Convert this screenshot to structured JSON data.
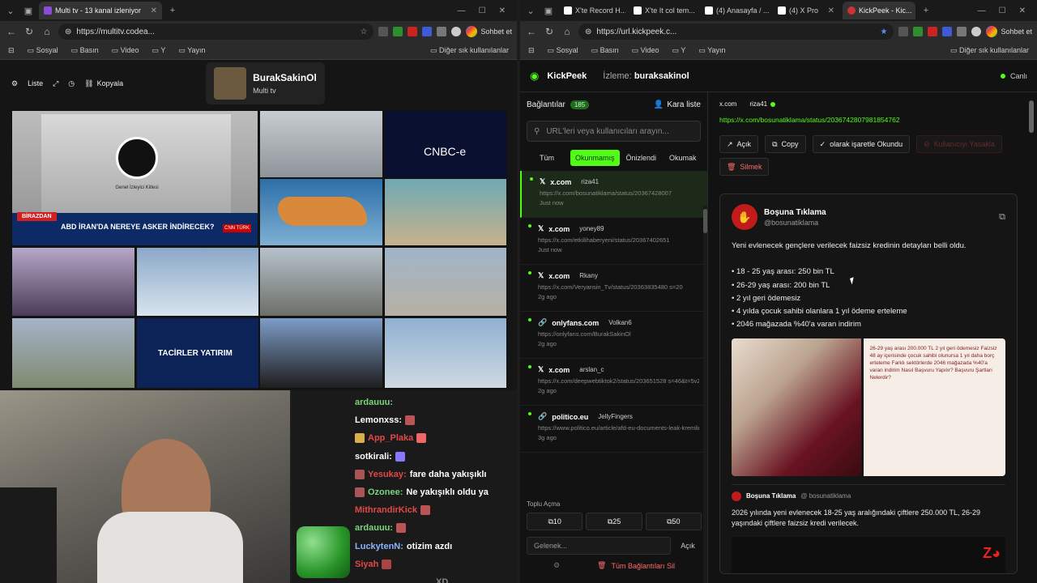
{
  "left_browser": {
    "tab": {
      "title": "Multi tv - 13 kanal izleniyor"
    },
    "url": "https://multitv.codea...",
    "chat_button": "Sohbet et",
    "bookmarks": [
      "Sosyal",
      "Basın",
      "Video",
      "Y",
      "Yayın"
    ],
    "bookmarks_right": "Diğer sık kullanılanlar"
  },
  "multitv": {
    "toolbar": {
      "list_label": "Liste",
      "copy_label": "Kopyala"
    },
    "profile": {
      "name": "BurakSakinOl",
      "subtitle": "Multi tv"
    },
    "channels": {
      "c1_caption": "Genel İzleyici Kitlesi",
      "c1_headline": "ABD İRAN'DA NEREYE ASKER İNDİRECEK?",
      "c1_badge": "BİRAZDAN",
      "c1_logo": "CNN TÜRK",
      "c2_logo": "CNBC-e",
      "c3_logo": "TACİRLER YATIRIM"
    }
  },
  "stream_chat": [
    {
      "user": "ardauuu:",
      "msg": "",
      "user_color": "#7ad47a"
    },
    {
      "user": "Lemonxss:",
      "msg": "",
      "user_color": "#ffffff"
    },
    {
      "user": "App_Plaka",
      "msg": "",
      "user_color": "#e34848"
    },
    {
      "user": "sotkirali:",
      "msg": "",
      "user_color": "#ffffff"
    },
    {
      "user": "Yesukay:",
      "msg": "fare daha yakışıklı",
      "user_color": "#e34848"
    },
    {
      "user": "Ozonee:",
      "msg": "Ne yakışıklı oldu ya",
      "user_color": "#7ad47a"
    },
    {
      "user": "MithrandirKick",
      "msg": "",
      "user_color": "#e34848"
    },
    {
      "user": "ardauuu:",
      "msg": "",
      "user_color": "#7ad47a"
    },
    {
      "user": "LuckytenN:",
      "msg": "otizim azdı",
      "user_color": "#8ab4ff"
    },
    {
      "user": "Siyah",
      "msg": "",
      "user_color": "#e34848"
    },
    {
      "user": "",
      "msg": "XD",
      "user_color": "#e34848"
    }
  ],
  "right_browser": {
    "tabs": [
      {
        "title": "X'te Record H..."
      },
      {
        "title": "X'te It col tem..."
      },
      {
        "title": "(4) Anasayfa / ..."
      },
      {
        "title": "(4) X Pro"
      },
      {
        "title": "KickPeek - Kic..."
      }
    ],
    "url": "https://url.kickpeek.c...",
    "chat_button": "Sohbet et",
    "bookmarks": [
      "Sosyal",
      "Basın",
      "Video",
      "Y",
      "Yayın"
    ],
    "bookmarks_right": "Diğer sık kullanılanlar"
  },
  "kickpeek": {
    "brand": "KickPeek",
    "watching_label": "İzleme:",
    "watching_user": "buraksakinol",
    "live_label": "Canlı",
    "links_label": "Bağlantılar",
    "links_count": "185",
    "blacklist_label": "Kara liste",
    "search_placeholder": "URL'leri veya kullanıcıları arayın...",
    "filters": [
      "Tüm",
      "Okunmamış",
      "Önizlendi",
      "Okumak"
    ],
    "items": [
      {
        "site": "x.com",
        "user": "riza41",
        "url": "https://x.com/bosunatiklama/status/20367428007",
        "time": "Just now"
      },
      {
        "site": "x.com",
        "user": "yoney89",
        "url": "https://x.com/etkilihaberyeni/status/20367402651",
        "time": "Just now"
      },
      {
        "site": "x.com",
        "user": "Rkany",
        "url": "https://x.com/Veryansin_Tv/status/20363835480 s=20",
        "time": "2g ago"
      },
      {
        "site": "onlyfans.com",
        "user": "Volkan6",
        "url": "https://onlyfans.com/BurakSakinOl",
        "time": "2g ago"
      },
      {
        "site": "x.com",
        "user": "arslan_c",
        "url": "https://x.com/deepwebtiktok2/status/203651528 s=46&t=5vZ3M0iVAaWywAHFkR9hA",
        "time": "2g ago"
      },
      {
        "site": "politico.eu",
        "user": "JellyFingers",
        "url": "https://www.politico.eu/article/afd-eu-documents-leak-kremlin/",
        "time": "3g ago"
      }
    ],
    "bulk_label": "Toplu Açma",
    "bulk_buttons": [
      "10",
      "25",
      "50"
    ],
    "goto_placeholder": "Gelenek...",
    "goto_button": "Açık",
    "delete_all": "Tüm Bağlantıları Sil",
    "detail": {
      "site": "x.com",
      "user": "riza41",
      "link": "https://x.com/bosunatiklama/status/2036742807981854762",
      "actions": {
        "open": "Açık",
        "copy": "Copy",
        "mark": "olarak işaretle Okundu",
        "ban": "Kullanıcıyı Yasakla",
        "delete": "Silmek"
      },
      "tweet": {
        "name": "Boşuna Tıklama",
        "handle": "@bosunatiklama",
        "text_main": "Yeni evlenecek gençlere verilecek faizsiz kredinin detayları belli oldu.",
        "bullets": [
          "• 18 - 25 yaş arası: 250 bin TL",
          "• 26-29 yaş arası: 200 bin TL",
          "• 2 yıl geri ödemesiz",
          "• 4 yılda çocuk sahibi olanlara 1 yıl ödeme erteleme",
          "• 2046 mağazada %40'a varan indirim"
        ],
        "img_caption": "26-29 yaş arası 200.000 TL 2 yıl geri ödemesiz Faizsiz 48 ay içerisinde çocuk sahibi olunursa 1 yıl daha borç erteleme Farklı sektörlerde 2046 mağazada %40'a varan indirim Nasıl Başvuru Yapılır? Başvuru Şartları Nelerdir?",
        "quote_name": "Boşuna Tıklama",
        "quote_handle": "@ bosunatiklama",
        "quote_text": "2026 yılında yeni evlenecek 18-25 yaş aralığındaki çiftlere 250.000 TL, 26-29 yaşındaki çiftlere faizsiz kredi verilecek."
      }
    }
  },
  "colors": {
    "accent": "#53fc18",
    "danger": "#ff6b6b",
    "news_red": "#d21f1f"
  }
}
